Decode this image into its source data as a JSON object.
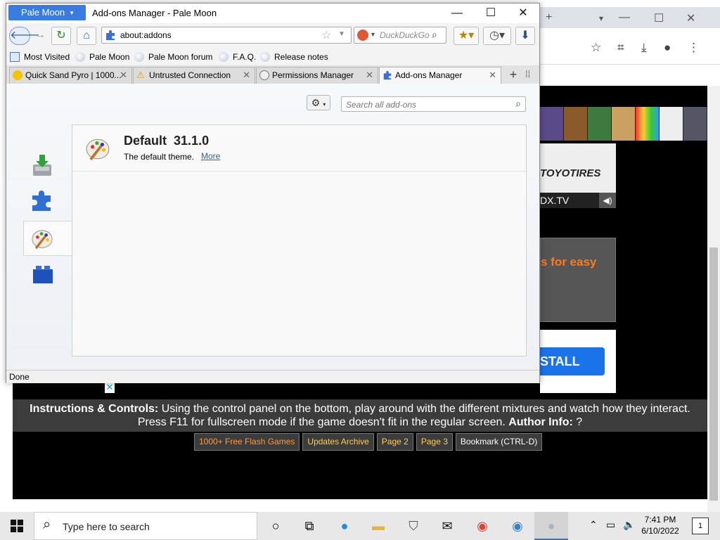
{
  "background_browser": {
    "window_controls": {
      "minimize": "—",
      "maximize": "☐",
      "close": "✕"
    },
    "new_tab": "+",
    "dropdown": "▾"
  },
  "game_page": {
    "instructions_label": "Instructions & Controls:",
    "instructions_text": "Using the control panel on the bottom, play around with the different mixtures and watch how they interact.",
    "fullscreen_text": "Press F11 for fullscreen mode if the game doesn't fit in the regular screen.",
    "author_label": "Author Info:",
    "author_value": "?",
    "links": [
      "1000+ Free Flash Games",
      "Updates Archive",
      "Page 2",
      "Page 3",
      "Bookmark (CTRL-D)"
    ],
    "ads": {
      "toyo": "TOYOTIRES",
      "dx": "DX.TV",
      "easy": "s for easy",
      "install": "STALL",
      "close": "✕"
    }
  },
  "palemoon": {
    "menu_button": "Pale Moon",
    "window_title": "Add-ons Manager - Pale Moon",
    "window_controls": {
      "minimize": "—",
      "maximize": "☐",
      "close": "✕"
    },
    "url": "about:addons",
    "search_placeholder": "DuckDuckGo",
    "bookmarks": [
      "Most Visited",
      "Pale Moon",
      "Pale Moon forum",
      "F.A.Q.",
      "Release notes"
    ],
    "tabs": [
      {
        "title": "Quick Sand Pyro | 1000...",
        "active": false
      },
      {
        "title": "Untrusted Connection",
        "active": false
      },
      {
        "title": "Permissions Manager",
        "active": false
      },
      {
        "title": "Add-ons Manager",
        "active": true
      }
    ],
    "tab_close": "✕",
    "addon_search_placeholder": "Search all add-ons",
    "categories": [
      "get-addons",
      "extensions",
      "appearance",
      "plugins"
    ],
    "selected_category": "appearance",
    "theme": {
      "name": "Default",
      "version": "31.1.0",
      "description": "The default theme.",
      "more_link": "More"
    },
    "status": "Done"
  },
  "taskbar": {
    "search_placeholder": "Type here to search",
    "time": "7:41 PM",
    "date": "6/10/2022",
    "notifications": "1"
  }
}
